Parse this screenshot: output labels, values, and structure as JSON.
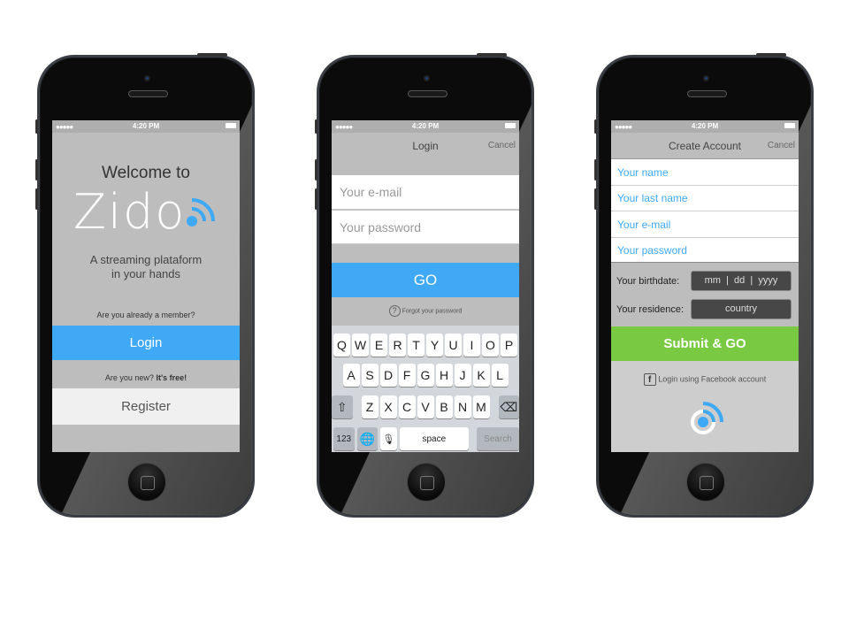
{
  "status_bar": {
    "signal": "●●●●●",
    "time": "4:20 PM"
  },
  "welcome": {
    "title": "Welcome to",
    "logo": "Zido",
    "tagline_1": "A streaming plataform",
    "tagline_2": "in your hands",
    "member_prompt": "Are you already a member?",
    "login_label": "Login",
    "new_prompt": "Are you new?",
    "free_label": "It's free!",
    "register_label": "Register"
  },
  "login": {
    "title": "Login",
    "cancel": "Cancel",
    "email_placeholder": "Your e-mail",
    "password_placeholder": "Your password",
    "go_label": "GO",
    "forgot_label": "Forgot your password",
    "keyboard": {
      "row1": [
        "Q",
        "W",
        "E",
        "R",
        "T",
        "Y",
        "U",
        "I",
        "O",
        "P"
      ],
      "row2": [
        "A",
        "S",
        "D",
        "F",
        "G",
        "H",
        "J",
        "K",
        "L"
      ],
      "row3": [
        "Z",
        "X",
        "C",
        "V",
        "B",
        "N",
        "M"
      ],
      "numbers": "123",
      "space": "space",
      "search": "Search"
    }
  },
  "create": {
    "title": "Create Account",
    "cancel": "Cancel",
    "name_placeholder": "Your name",
    "last_name_placeholder": "Your last name",
    "email_placeholder": "Your e-mail",
    "password_placeholder": "Your password",
    "birthdate_label": "Your birthdate:",
    "birthdate_value": "mm  |  dd  |  yyyy",
    "residence_label": "Your residence:",
    "residence_value": "country",
    "submit_label": "Submit & GO",
    "facebook_label": "Login using Facebook account"
  },
  "colors": {
    "accent": "#3fa9f5",
    "submit": "#7ac943"
  }
}
